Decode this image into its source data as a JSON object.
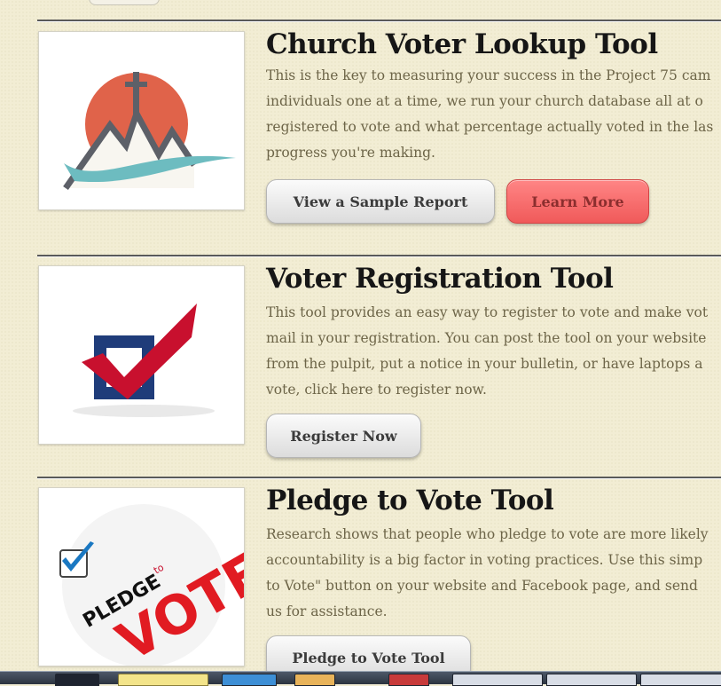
{
  "tools": [
    {
      "title": "Church Voter Lookup Tool",
      "desc": [
        "This is the key to measuring your success in the Project 75 cam",
        "individuals one at a time, we run your church database all at o",
        "registered to vote and what percentage actually voted in the las",
        "progress you're making."
      ],
      "buttons": [
        "View a Sample Report",
        "Learn More"
      ],
      "icon": "church-sunrise-icon"
    },
    {
      "title": "Voter Registration Tool",
      "desc": [
        "This tool provides an easy way to register to vote and make vot",
        "mail in your registration. You can post the tool on your website",
        "from the pulpit, put a notice in your bulletin, or have laptops a",
        "vote, click here to register now."
      ],
      "buttons": [
        "Register Now"
      ],
      "icon": "checkbox-check-icon"
    },
    {
      "title": "Pledge to Vote Tool",
      "desc": [
        "Research shows that people who pledge to vote are more likely",
        "accountability is a big factor in voting practices.  Use this simp",
        "to Vote\" button on your website and Facebook page, and send",
        "us for assistance."
      ],
      "buttons": [
        "Pledge to Vote Tool"
      ],
      "icon": "pledge-to-vote-icon",
      "logo_text": {
        "pledge": "PLEDGE",
        "to": "to",
        "vote": "VOTE"
      }
    }
  ],
  "colors": {
    "background": "#f2edd4",
    "title": "#161616",
    "body_text": "#6d6548",
    "red_button": "#f46a6a",
    "sun": "#e0634a",
    "wave": "#6dbcc0",
    "check_red": "#c8102e",
    "box_navy": "#1f3c7a"
  }
}
